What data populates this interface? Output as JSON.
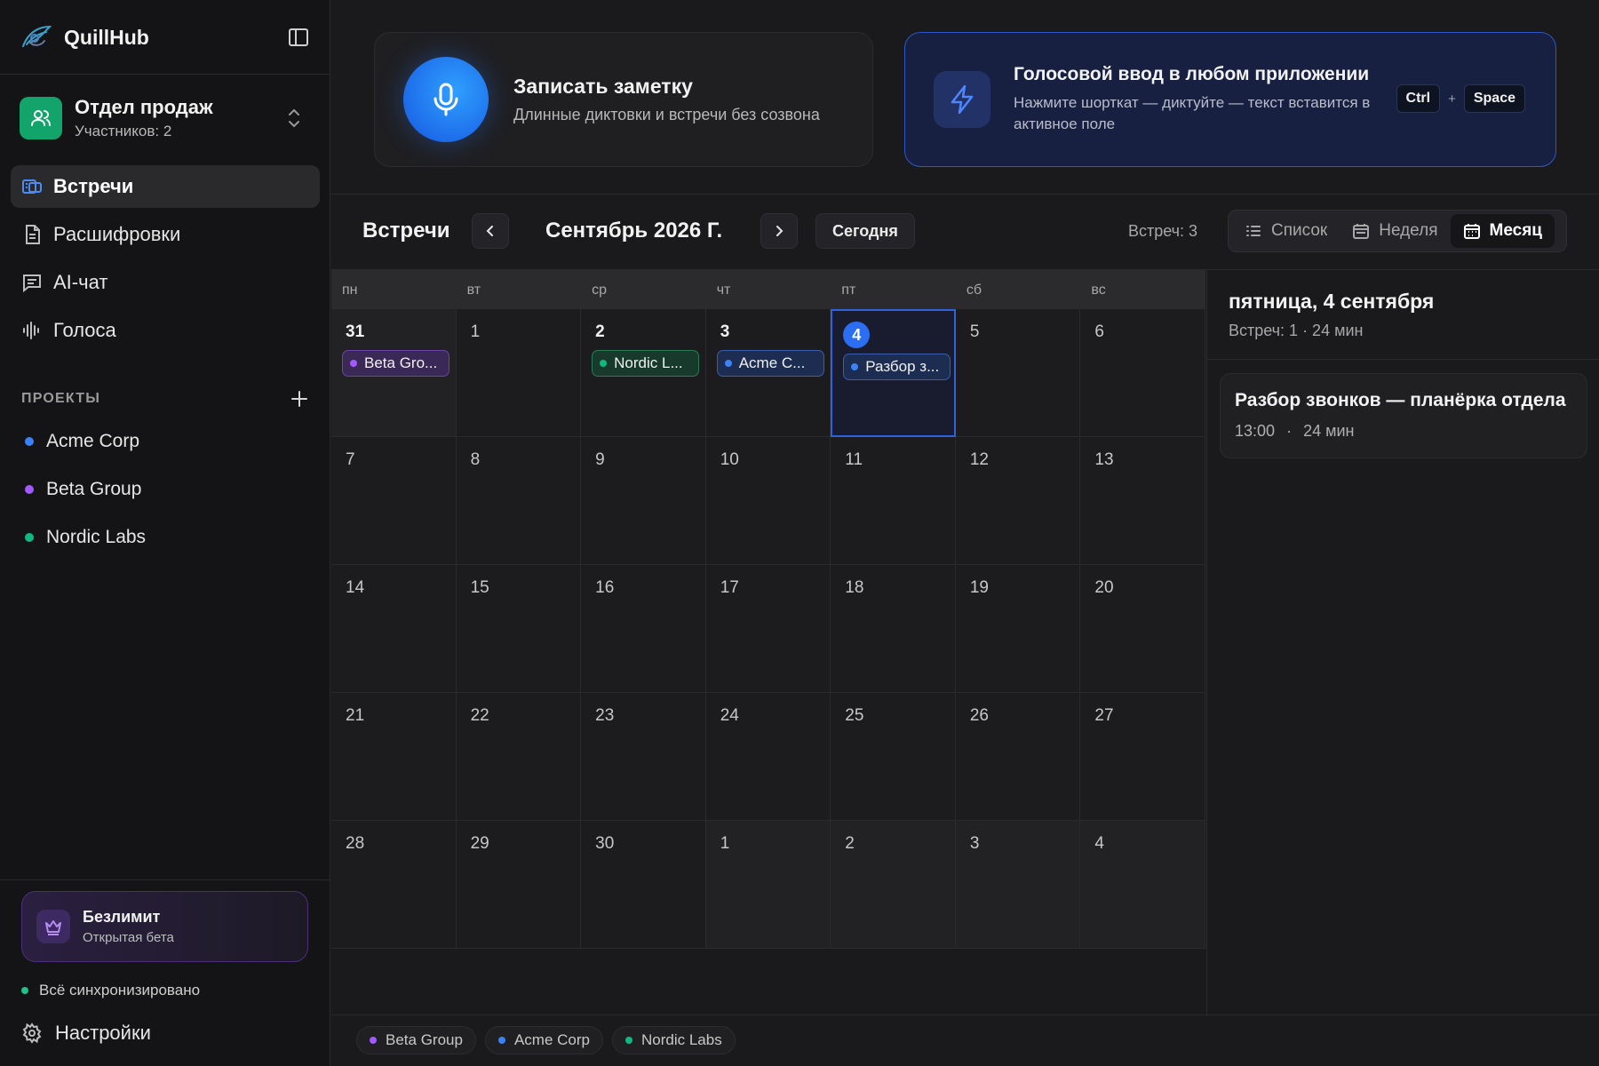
{
  "brand": {
    "name": "QuillHub"
  },
  "team": {
    "name": "Отдел продаж",
    "members": "Участников: 2"
  },
  "nav": {
    "meetings": "Встречи",
    "transcripts": "Расшифровки",
    "ai_chat": "AI-чат",
    "voices": "Голоса"
  },
  "projects": {
    "title": "ПРОЕКТЫ",
    "items": [
      {
        "name": "Acme Corp",
        "color": "#3b82f6"
      },
      {
        "name": "Beta Group",
        "color": "#a259ff"
      },
      {
        "name": "Nordic Labs",
        "color": "#10b981"
      }
    ]
  },
  "plan": {
    "title": "Безлимит",
    "subtitle": "Открытая бета"
  },
  "sync": {
    "status": "Всё синхронизировано"
  },
  "settings": {
    "label": "Настройки"
  },
  "record_card": {
    "title": "Записать заметку",
    "subtitle": "Длинные диктовки и встречи без созвона"
  },
  "voice_card": {
    "title": "Голосовой ввод в любом приложении",
    "subtitle": "Нажмите шорткат — диктуйте — текст вставится в активное поле",
    "key1": "Ctrl",
    "plus": "+",
    "key2": "Space"
  },
  "toolbar": {
    "title": "Встречи",
    "month": "Сентябрь 2026 Г.",
    "today": "Сегодня",
    "count": "Встреч: 3",
    "view_list": "Список",
    "view_week": "Неделя",
    "view_month": "Месяц"
  },
  "calendar": {
    "weekdays": [
      "пн",
      "вт",
      "ср",
      "чт",
      "пт",
      "сб",
      "вс"
    ],
    "weeks": [
      [
        "31",
        "1",
        "2",
        "3",
        "4",
        "5",
        "6"
      ],
      [
        "7",
        "8",
        "9",
        "10",
        "11",
        "12",
        "13"
      ],
      [
        "14",
        "15",
        "16",
        "17",
        "18",
        "19",
        "20"
      ],
      [
        "21",
        "22",
        "23",
        "24",
        "25",
        "26",
        "27"
      ],
      [
        "28",
        "29",
        "30",
        "1",
        "2",
        "3",
        "4"
      ]
    ],
    "events": {
      "aug31": "Beta Gro...",
      "sep2": "Nordic L...",
      "sep3": "Acme C...",
      "sep4": "Разбор з..."
    }
  },
  "day_panel": {
    "title": "пятница, 4 сентября",
    "summary": "Встреч: 1 · 24 мин",
    "meeting": {
      "title": "Разбор звонков — планёрка отдела",
      "time": "13:00",
      "sep": "·",
      "duration": "24 мин"
    }
  },
  "legend": [
    "Beta Group",
    "Acme Corp",
    "Nordic Labs"
  ],
  "colors": {
    "accent": "#2c6ef2",
    "beta": "#a259ff",
    "acme": "#3b82f6",
    "nordic": "#10b981",
    "sync": "#1ec28b"
  }
}
